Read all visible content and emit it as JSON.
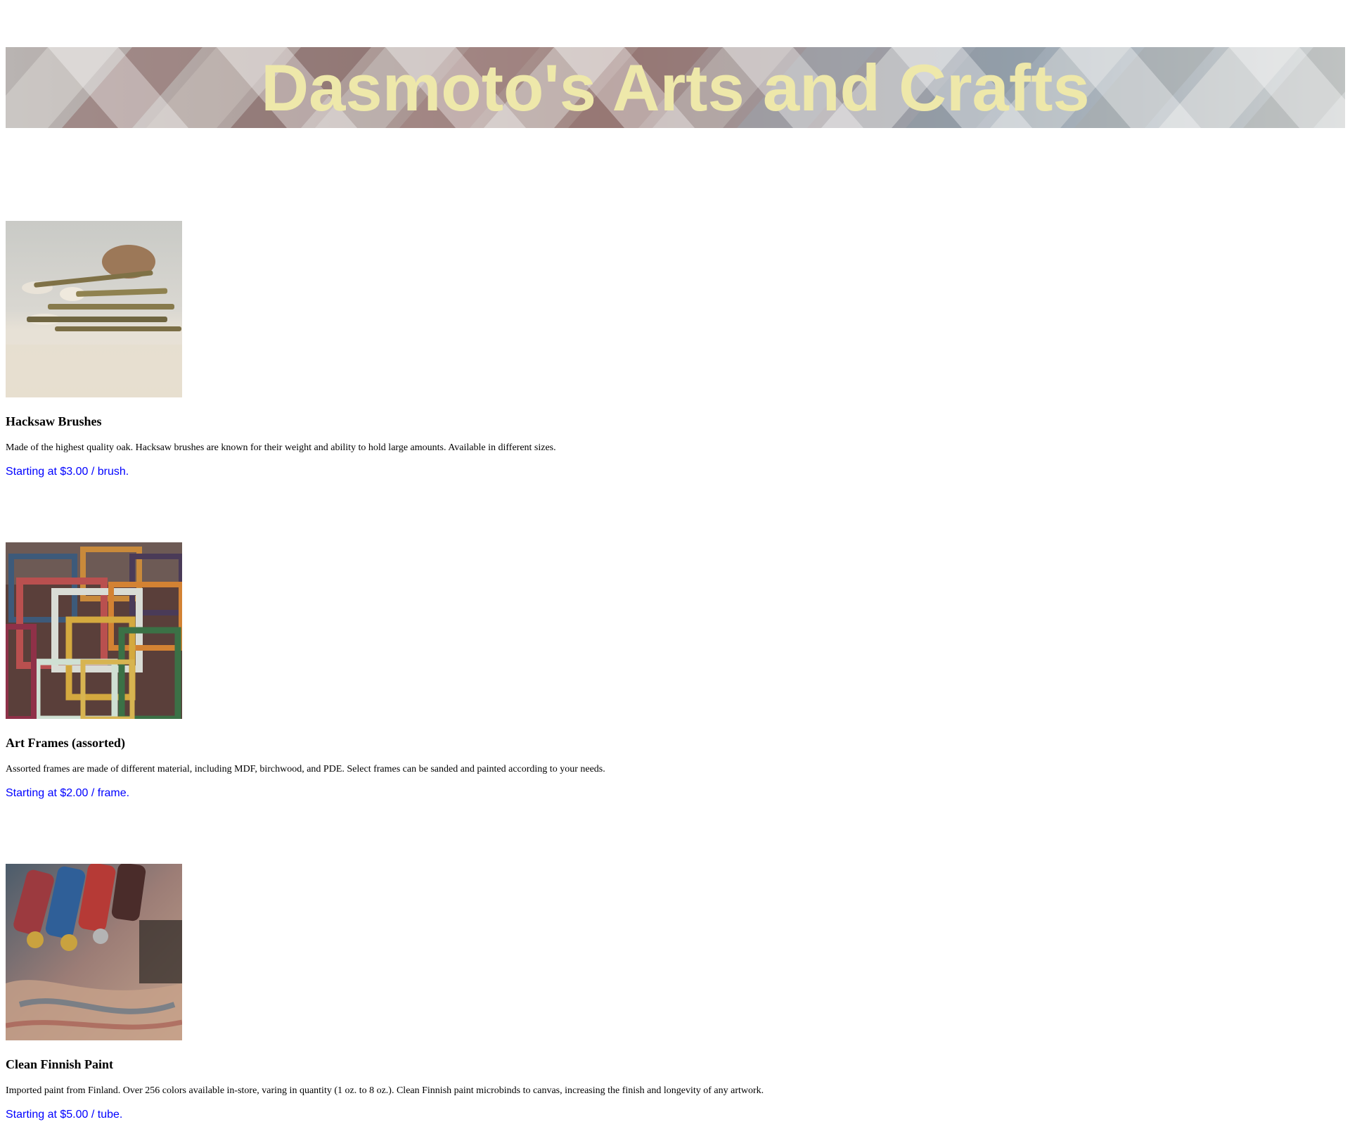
{
  "header": {
    "title": "Dasmoto's Arts and Crafts",
    "title_color": "#EEE8AA"
  },
  "products": [
    {
      "name": "Hacksaw Brushes",
      "description": "Made of the highest quality oak. Hacksaw brushes are known for their weight and ability to hold large amounts. Available in different sizes.",
      "price": "Starting at $3.00 / brush."
    },
    {
      "name": "Art Frames (assorted)",
      "description": "Assorted frames are made of different material, including MDF, birchwood, and PDE. Select frames can be sanded and painted according to your needs.",
      "price": "Starting at $2.00 / frame."
    },
    {
      "name": "Clean Finnish Paint",
      "description": "Imported paint from Finland. Over 256 colors available in-store, varing in quantity (1 oz. to 8 oz.). Clean Finnish paint microbinds to canvas, increasing the finish and longevity of any artwork.",
      "price": "Starting at $5.00 / tube."
    }
  ],
  "colors": {
    "price_text": "#0000FF",
    "body_text": "#000000",
    "background": "#FFFFFF"
  }
}
